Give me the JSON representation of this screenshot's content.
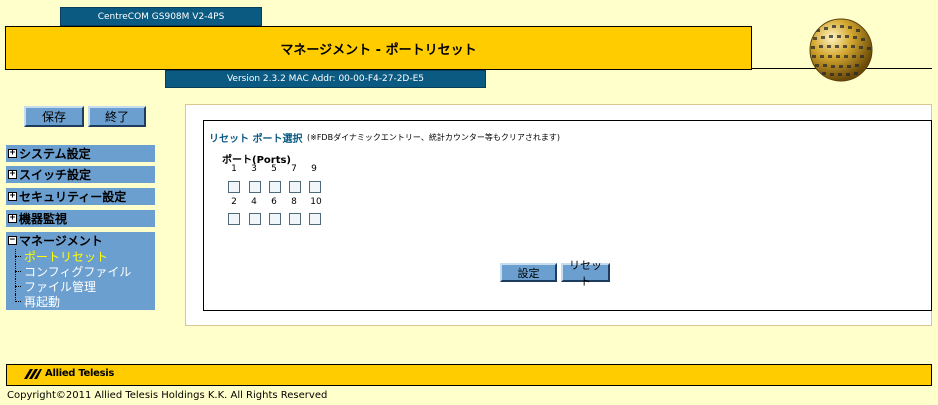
{
  "header": {
    "product": "CentreCOM GS908M V2-4PS",
    "title": "マネージメント - ポートリセット",
    "version": "Version 2.3.2 MAC Addr: 00-00-F4-27-2D-E5"
  },
  "buttons": {
    "save": "保存",
    "exit": "終了",
    "apply": "設定",
    "reset": "リセット"
  },
  "sidebar": {
    "system": "システム設定",
    "switch": "スイッチ設定",
    "security": "セキュリティー設定",
    "monitor": "機器監視",
    "management": "マネージメント",
    "sub_items": [
      "ポートリセット",
      "コンフィグファイル",
      "ファイル管理",
      "再起動"
    ],
    "expand_icon": "+",
    "collapse_icon": "−"
  },
  "main": {
    "section_title": "リセット ポート選択",
    "section_note": "(※FDBダイナミックエントリー、統計カウンター等もクリアされます)",
    "ports_label": "ポート(Ports)",
    "odd_ports": [
      "1",
      "3",
      "5",
      "7",
      "9"
    ],
    "even_ports": [
      "2",
      "4",
      "6",
      "8",
      "10"
    ]
  },
  "footer": {
    "brand": "Allied Telesis",
    "copyright": "Copyright©2011 Allied Telesis Holdings K.K. All Rights Reserved"
  },
  "colors": {
    "background": "#ffffcc",
    "banner": "#ffcc00",
    "nav": "#6b9fd0",
    "bar": "#0b5a82",
    "active": "#ffff00"
  }
}
